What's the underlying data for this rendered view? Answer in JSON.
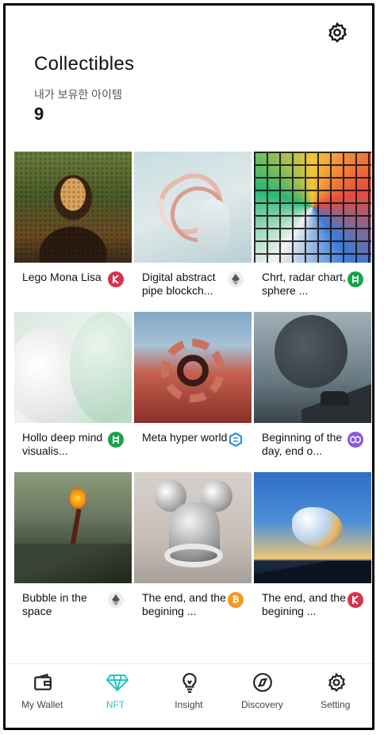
{
  "header": {
    "title": "Collectibles",
    "subtitle": "내가 보유한 아이템",
    "count": "9",
    "settings_icon": "gear-icon"
  },
  "items": [
    {
      "title": "Lego Mona Lisa",
      "chain_icon": "kyber-icon",
      "chain_color": "#d6334f"
    },
    {
      "title": "Digital abstract pipe  blockch...",
      "chain_icon": "ethereum-icon",
      "chain_color": "#e8e8e8"
    },
    {
      "title": "Chrt, radar chart, sphere ...",
      "chain_icon": "hedera-icon",
      "chain_color": "#1aa34a"
    },
    {
      "title": "Hollo deep mind visualis...",
      "chain_icon": "hedera-icon",
      "chain_color": "#1aa34a"
    },
    {
      "title": "Meta hyper world",
      "chain_icon": "hexagon-chain-icon",
      "chain_color": "#2d8fd6"
    },
    {
      "title": "Beginning of the day, end o...",
      "chain_icon": "polygon-icon",
      "chain_color": "#8a5ad8"
    },
    {
      "title": "Bubble in the space",
      "chain_icon": "ethereum-icon",
      "chain_color": "#e8e8e8"
    },
    {
      "title": "The end, and the begining ...",
      "chain_icon": "bitcoin-icon",
      "chain_color": "#f39a22"
    },
    {
      "title": "The end, and the begining ...",
      "chain_icon": "kyber-icon",
      "chain_color": "#d6334f"
    }
  ],
  "tabbar": {
    "tabs": [
      {
        "label": "My Wallet",
        "icon": "wallet-icon"
      },
      {
        "label": "NFT",
        "icon": "diamond-icon",
        "active": true
      },
      {
        "label": "Insight",
        "icon": "lightbulb-icon"
      },
      {
        "label": "Discovery",
        "icon": "compass-icon"
      },
      {
        "label": "Setting",
        "icon": "gear-icon"
      }
    ],
    "active_color": "#22c4c4"
  }
}
